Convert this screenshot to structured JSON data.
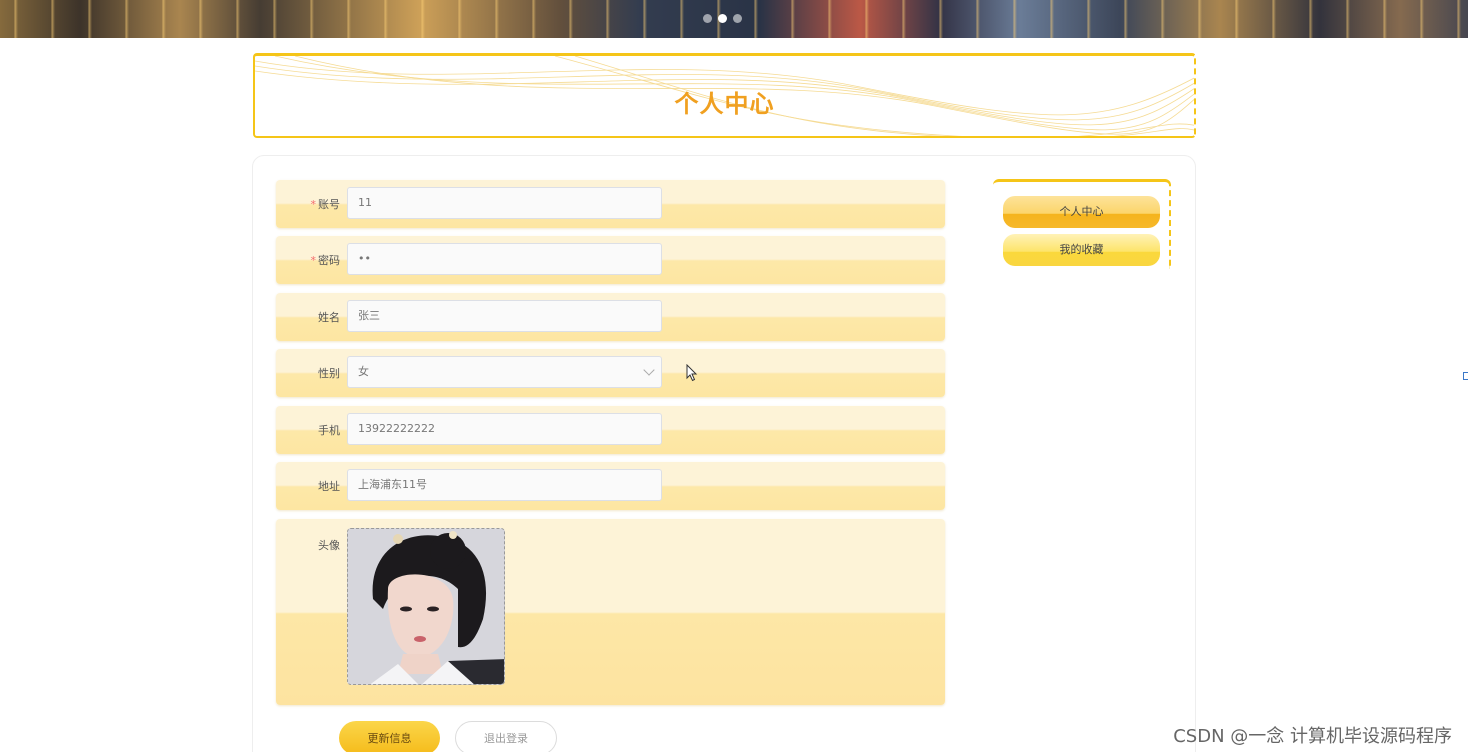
{
  "page": {
    "title": "个人中心"
  },
  "banner": {
    "slides": 3,
    "active_slide": 2
  },
  "form": {
    "account": {
      "label": "账号",
      "required": true,
      "value": "11"
    },
    "password": {
      "label": "密码",
      "required": true,
      "value": "••"
    },
    "name": {
      "label": "姓名",
      "value": "张三"
    },
    "gender": {
      "label": "性别",
      "value": "女"
    },
    "phone": {
      "label": "手机",
      "value": "13922222222"
    },
    "address": {
      "label": "地址",
      "value": "上海浦东11号"
    },
    "avatar": {
      "label": "头像"
    }
  },
  "actions": {
    "update": "更新信息",
    "logout": "退出登录"
  },
  "side_menu": {
    "items": [
      {
        "label": "个人中心",
        "active": true
      },
      {
        "label": "我的收藏",
        "active": false
      }
    ]
  },
  "watermark": "CSDN @一念 计算机毕设源码程序",
  "colors": {
    "accent": "#f5c518",
    "title": "#f0a020",
    "row_bg": "#fde8a8",
    "required": "#f56c6c"
  }
}
